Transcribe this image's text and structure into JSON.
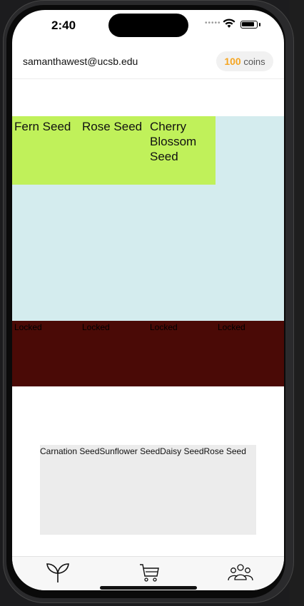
{
  "status": {
    "time": "2:40"
  },
  "header": {
    "email": "samanthawest@ucsb.edu",
    "coins_value": "100",
    "coins_unit": "coins"
  },
  "garden": {
    "seeds": [
      "Fern Seed",
      "Rose Seed",
      "Cherry Blossom Seed"
    ],
    "locked": [
      "Locked",
      "Locked",
      "Locked",
      "Locked"
    ]
  },
  "shop": {
    "items": [
      "Carnation Seed",
      "Sunflower Seed",
      "Daisy Seed",
      "Rose Seed"
    ]
  },
  "tabs": [
    {
      "icon": "plant-icon"
    },
    {
      "icon": "cart-icon"
    },
    {
      "icon": "community-icon"
    }
  ],
  "colors": {
    "seed_row": "#c0f15a",
    "garden_bg": "#d4ecee",
    "locked_bg": "#4a0a06",
    "shop_bg": "#ececec",
    "coins_accent": "#f5a623"
  }
}
